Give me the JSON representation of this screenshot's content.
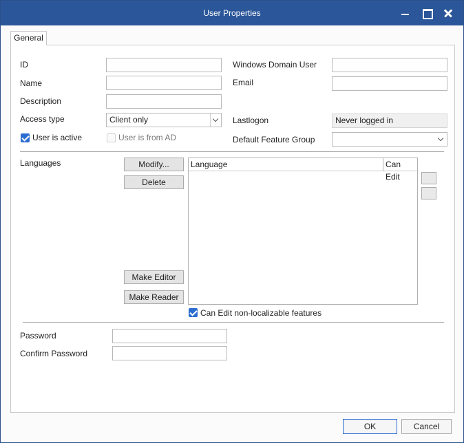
{
  "window": {
    "title": "User Properties"
  },
  "tabs": [
    {
      "label": "General",
      "selected": true
    }
  ],
  "form": {
    "id": {
      "label": "ID",
      "value": ""
    },
    "name": {
      "label": "Name",
      "value": ""
    },
    "description": {
      "label": "Description",
      "value": ""
    },
    "access_type": {
      "label": "Access type",
      "selected": "Client only"
    },
    "user_is_active": {
      "label": "User is active",
      "checked": true
    },
    "user_is_from_ad": {
      "label": "User is from AD",
      "checked": false,
      "enabled": false
    },
    "windows_domain_user": {
      "label": "Windows Domain User",
      "value": ""
    },
    "email": {
      "label": "Email",
      "value": ""
    },
    "last_logon": {
      "label": "Lastlogon",
      "value": "Never logged in"
    },
    "default_feature_group": {
      "label": "Default Feature Group",
      "selected": ""
    }
  },
  "languages": {
    "label": "Languages",
    "buttons": {
      "modify": "Modify...",
      "delete": "Delete",
      "make_editor": "Make Editor",
      "make_reader": "Make Reader"
    },
    "columns": [
      "Language",
      "Can Edit"
    ],
    "rows": [],
    "can_edit_non_localizable": {
      "label": "Can Edit non-localizable features",
      "checked": true
    }
  },
  "password": {
    "password": {
      "label": "Password",
      "value": ""
    },
    "confirm": {
      "label": "Confirm Password",
      "value": ""
    }
  },
  "footer": {
    "ok": "OK",
    "cancel": "Cancel"
  },
  "colors": {
    "titlebar": "#2b579a",
    "accent": "#2b6cd0"
  }
}
